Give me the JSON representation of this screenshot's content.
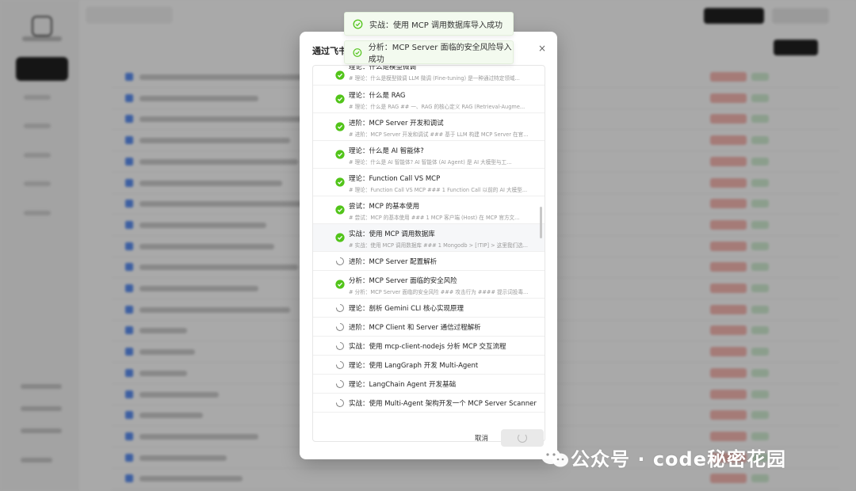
{
  "toasts": [
    {
      "text": "实战：使用 MCP 调用数据库导入成功"
    },
    {
      "text": "分析：MCP Server 面临的安全风险导入成功"
    }
  ],
  "modal": {
    "title": "通过飞书",
    "close_label": "×",
    "cancel_label": "取消",
    "items": [
      {
        "title": "理论：什么是模型微调",
        "sub": "# 理论：什么是模型微调 LLM 微调 (Fine-tuning) 是一种通过特定领域...",
        "status": "done"
      },
      {
        "title": "理论：什么是 RAG",
        "sub": "# 理论：什么是 RAG ## 一、RAG 的核心定义 RAG (Retrieval-Augme...",
        "status": "done"
      },
      {
        "title": "进阶：MCP Server 开发和调试",
        "sub": "# 进阶：MCP Server 开发和调试 ### 基于 LLM 构建 MCP Server 在官...",
        "status": "done"
      },
      {
        "title": "理论：什么是 AI 智能体?",
        "sub": "# 理论：什么是 AI 智能体? AI 智能体 (AI Agent) 是 AI 大模型与工...",
        "status": "done"
      },
      {
        "title": "理论：Function Call VS MCP",
        "sub": "# 理论：Function Call VS MCP ### 1 Function Call 以前的 AI 大模型...",
        "status": "done"
      },
      {
        "title": "尝试：MCP 的基本使用",
        "sub": "# 尝试：MCP 的基本使用 ### 1 MCP 客户端 (Host) 在 MCP 官方文...",
        "status": "done"
      },
      {
        "title": "实战：使用 MCP 调用数据库",
        "sub": "# 实战：使用 MCP 调用数据库 ### 1 Mongodb > [!TIP] > 这里我们选...",
        "status": "done",
        "highlight": true
      },
      {
        "title": "进阶：MCP Server 配置解析",
        "sub": "",
        "status": "pending"
      },
      {
        "title": "分析：MCP Server 面临的安全风险",
        "sub": "# 分析：MCP Server 面临的安全风险 ### 攻击行为 #### 提示词投毒...",
        "status": "done"
      },
      {
        "title": "理论：剖析 Gemini CLI 核心实现原理",
        "sub": "",
        "status": "pending"
      },
      {
        "title": "进阶：MCP Client 和 Server 通信过程解析",
        "sub": "",
        "status": "pending"
      },
      {
        "title": "实战：使用 mcp-client-nodejs 分析 MCP 交互流程",
        "sub": "",
        "status": "pending"
      },
      {
        "title": "理论：使用 LangGraph 开发 Multi-Agent",
        "sub": "",
        "status": "pending"
      },
      {
        "title": "理论：LangChain Agent 开发基础",
        "sub": "",
        "status": "pending"
      },
      {
        "title": "实战：使用 Multi-Agent 架构开发一个 MCP Server Scanner",
        "sub": "",
        "status": "pending"
      }
    ]
  },
  "watermark": {
    "text": "公众号 · code秘密花园"
  },
  "colors": {
    "success": "#52c41a",
    "pending": "#8c8c8c",
    "sidebar_active": "#1f1f1f",
    "tag_red": "#f3b5b0"
  }
}
